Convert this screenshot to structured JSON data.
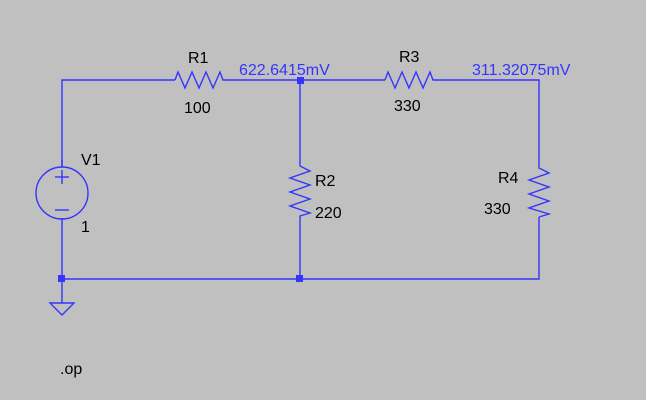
{
  "colors": {
    "background": "#c0c0c0",
    "wire": "#3434ff",
    "label": "#000000",
    "node_voltage": "#3434ff"
  },
  "components": {
    "V1": {
      "name": "V1",
      "value": "1"
    },
    "R1": {
      "name": "R1",
      "value": "100"
    },
    "R2": {
      "name": "R2",
      "value": "220"
    },
    "R3": {
      "name": "R3",
      "value": "330"
    },
    "R4": {
      "name": "R4",
      "value": "330"
    }
  },
  "node_voltages": {
    "n1": "622.6415mV",
    "n2": "311.32075mV"
  },
  "sim_directive": ".op"
}
